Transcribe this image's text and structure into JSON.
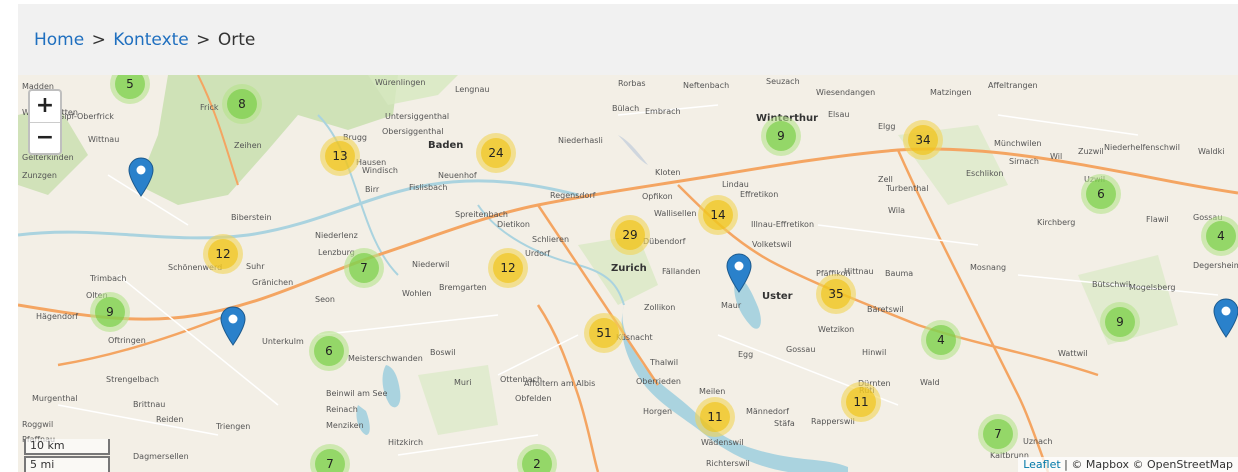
{
  "breadcrumb": {
    "home": "Home",
    "separator_1": ">",
    "kontexte": "Kontexte",
    "separator_2": ">",
    "current": "Orte"
  },
  "map": {
    "zoom_in": "+",
    "zoom_out": "−",
    "scale_km": "10 km",
    "scale_mi": "5 mi",
    "attribution_leaflet": "Leaflet",
    "attribution_rest": " | © Mapbox © OpenStreetMap",
    "colors": {
      "cluster_small": "#6ecc39",
      "cluster_medium": "#f0c20c",
      "marker": "#2a81cb",
      "water": "#aad3df",
      "forest": "#c8dfae"
    },
    "clusters": [
      {
        "count": "5",
        "size": "small"
      },
      {
        "count": "8",
        "size": "small"
      },
      {
        "count": "13",
        "size": "medium"
      },
      {
        "count": "24",
        "size": "medium"
      },
      {
        "count": "9",
        "size": "small"
      },
      {
        "count": "34",
        "size": "medium"
      },
      {
        "count": "6",
        "size": "small"
      },
      {
        "count": "4",
        "size": "small"
      },
      {
        "count": "14",
        "size": "medium"
      },
      {
        "count": "29",
        "size": "medium"
      },
      {
        "count": "12",
        "size": "medium"
      },
      {
        "count": "7",
        "size": "small"
      },
      {
        "count": "12",
        "size": "medium"
      },
      {
        "count": "35",
        "size": "medium"
      },
      {
        "count": "9",
        "size": "small"
      },
      {
        "count": "9",
        "size": "small"
      },
      {
        "count": "51",
        "size": "medium"
      },
      {
        "count": "6",
        "size": "small"
      },
      {
        "count": "4",
        "size": "small"
      },
      {
        "count": "11",
        "size": "medium"
      },
      {
        "count": "11",
        "size": "medium"
      },
      {
        "count": "7",
        "size": "small"
      },
      {
        "count": "7",
        "size": "small"
      },
      {
        "count": "2",
        "size": "small"
      }
    ],
    "places": [
      "Madden",
      "Frick",
      "Würenlingen",
      "Lengnau",
      "Rorbas",
      "Neftenbach",
      "Seuzach",
      "Wiesendangen",
      "Matzingen",
      "Affeltrangen",
      "Wegenstetten",
      "Gipf-Oberfrick",
      "Untersiggenthal",
      "Bülach",
      "Embrach",
      "Winterthur",
      "Elsau",
      "Elgg",
      "Wittnau",
      "Brugg",
      "Obersiggenthal",
      "Niederhasli",
      "Gelterkinden",
      "Zeihen",
      "Hausen",
      "Baden",
      "Münchwilen",
      "Zuzwil",
      "Niederhelfenschwil",
      "Waldki",
      "Zunzgen",
      "Windisch",
      "Neuenhof",
      "Kloten",
      "Sirnach",
      "Wil",
      "Birr",
      "Fislisbach",
      "Regensdorf",
      "Opfikon",
      "Lindau",
      "Zell",
      "Eschlikon",
      "Uzwil",
      "Effretikon",
      "Turbenthal",
      "Spreitenbach",
      "Wallisellen",
      "Illnau-Effretikon",
      "Wila",
      "Biberstein",
      "Dietikon",
      "Schlieren",
      "Kirchberg",
      "Flawil",
      "Gossau",
      "Niederlenz",
      "Lenzburg",
      "Volketswil",
      "Dübendorf",
      "Urdorf",
      "Trimbach",
      "Schönenwerd",
      "Suhr",
      "Niederwil",
      "Zurich",
      "Fällanden",
      "Pfäffikon",
      "Hittnau",
      "Bauma",
      "Mosnang",
      "Degersheim",
      "Gränichen",
      "Wohlen",
      "Bremgarten",
      "Uster",
      "Bütschwil",
      "Mogelsberg",
      "Olten",
      "Seon",
      "Zollikon",
      "Maur",
      "Bäretswil",
      "Hägendorf",
      "Oftringen",
      "Unterkulm",
      "Küsnacht",
      "Wetzikon",
      "Meisterschwanden",
      "Boswil",
      "Egg",
      "Gossau",
      "Hinwil",
      "Wattwil",
      "Thalwil",
      "Strengelbach",
      "Muri",
      "Ottenbach",
      "Affoltern am Albis",
      "Oberrieden",
      "Wald",
      "Murgenthal",
      "Brittnau",
      "Beinwil am See",
      "Obfelden",
      "Horgen",
      "Meilen",
      "Dürnten",
      "Reinach",
      "Reiden",
      "Menziken",
      "Männedorf",
      "Rüti",
      "Roggwil",
      "Triengen",
      "Hitzkirch",
      "Wädenswil",
      "Stäfa",
      "Rapperswil",
      "Pfaffnau",
      "Dagmersellen",
      "Richterswil",
      "Kaltbrunn",
      "Uznach"
    ]
  }
}
